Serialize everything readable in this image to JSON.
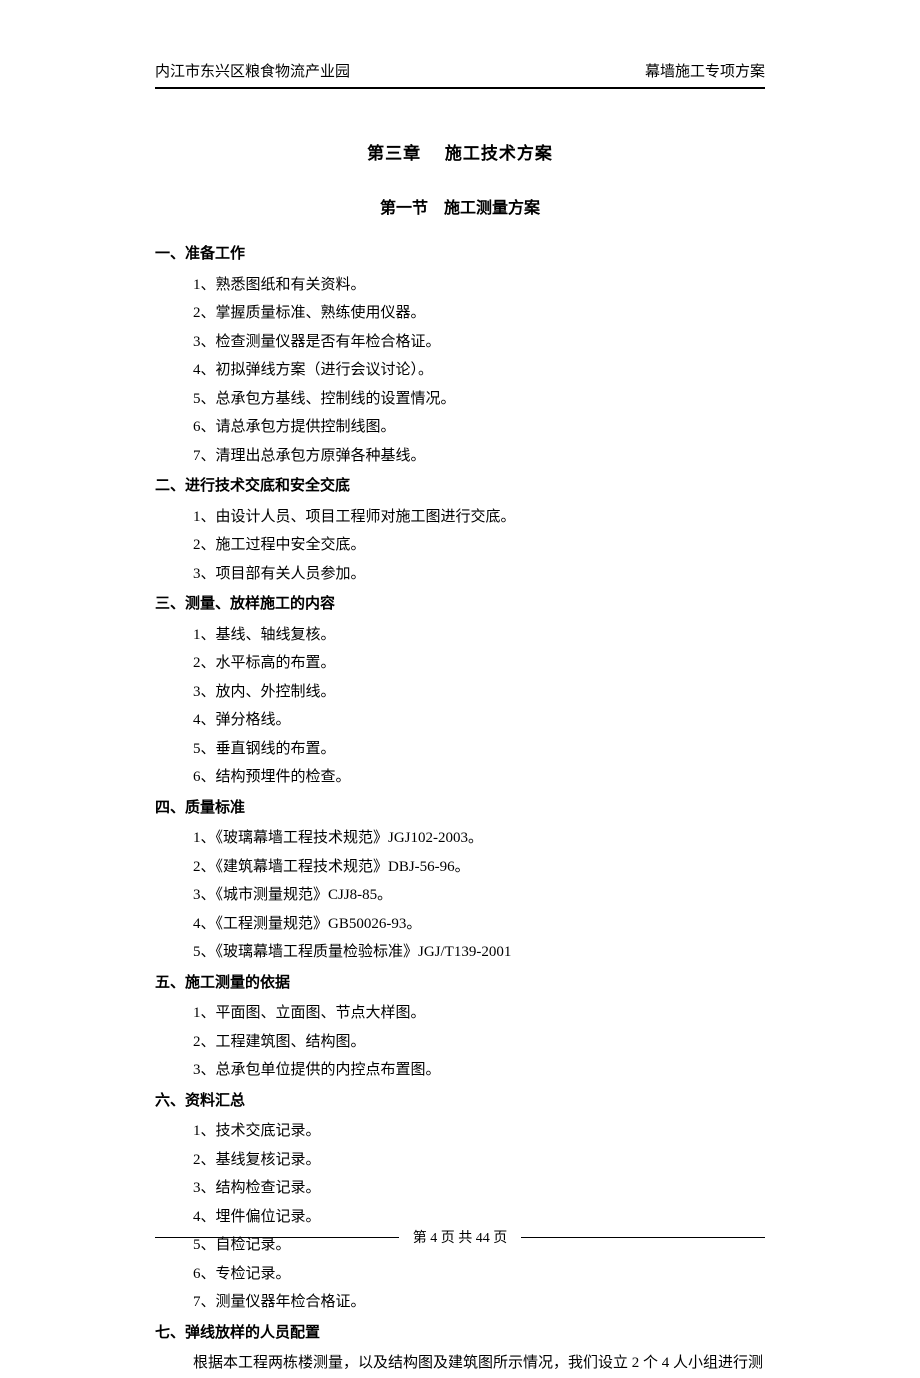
{
  "header": {
    "left": "内江市东兴区粮食物流产业园",
    "right": "幕墙施工专项方案"
  },
  "chapter_title": "第三章　 施工技术方案",
  "section_title": "第一节　施工测量方案",
  "sections": [
    {
      "heading": "一、准备工作",
      "items": [
        "1、熟悉图纸和有关资料。",
        "2、掌握质量标准、熟练使用仪器。",
        "3、检查测量仪器是否有年检合格证。",
        "4、初拟弹线方案（进行会议讨论）。",
        "5、总承包方基线、控制线的设置情况。",
        "6、请总承包方提供控制线图。",
        "7、清理出总承包方原弹各种基线。"
      ]
    },
    {
      "heading": "二、进行技术交底和安全交底",
      "items": [
        "1、由设计人员、项目工程师对施工图进行交底。",
        "2、施工过程中安全交底。",
        "3、项目部有关人员参加。"
      ]
    },
    {
      "heading": "三、测量、放样施工的内容",
      "items": [
        "1、基线、轴线复核。",
        "2、水平标高的布置。",
        "3、放内、外控制线。",
        "4、弹分格线。",
        "5、垂直钢线的布置。",
        "6、结构预埋件的检查。"
      ]
    },
    {
      "heading": "四、质量标准",
      "items": [
        "1、《玻璃幕墙工程技术规范》JGJ102-2003。",
        "2、《建筑幕墙工程技术规范》DBJ-56-96。",
        "3、《城市测量规范》CJJ8-85。",
        "4、《工程测量规范》GB50026-93。",
        "5、《玻璃幕墙工程质量检验标准》JGJ/T139-2001"
      ]
    },
    {
      "heading": "五、施工测量的依据",
      "items": [
        "1、平面图、立面图、节点大样图。",
        "2、工程建筑图、结构图。",
        "3、总承包单位提供的内控点布置图。"
      ]
    },
    {
      "heading": "六、资料汇总",
      "items": [
        "1、技术交底记录。",
        "2、基线复核记录。",
        "3、结构检查记录。",
        "4、埋件偏位记录。",
        "5、自检记录。",
        "6、专检记录。",
        "7、测量仪器年检合格证。"
      ]
    },
    {
      "heading": "七、弹线放样的人员配置",
      "paragraph": "根据本工程两栋楼测量，以及结构图及建筑图所示情况，我们设立 2 个 4 人小组进行测"
    }
  ],
  "footer": "第 4 页 共 44 页"
}
